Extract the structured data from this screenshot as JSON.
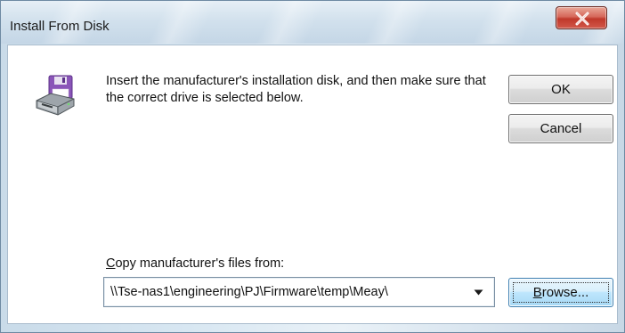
{
  "window": {
    "title": "Install From Disk"
  },
  "dialog": {
    "message": "Insert the manufacturer's installation disk, and then make sure that the correct drive is selected below.",
    "ok_label": "OK",
    "cancel_label": "Cancel",
    "copy_label_accel": "C",
    "copy_label_rest": "opy manufacturer's files from:",
    "path_value": "\\\\Tse-nas1\\engineering\\PJ\\Firmware\\temp\\Meay\\",
    "browse_accel": "B",
    "browse_rest": "rowse..."
  },
  "icons": {
    "disk": "floppy-disk-drive-icon",
    "close": "close-icon",
    "dropdown": "chevron-down-icon"
  },
  "colors": {
    "close_button": "#c0392b",
    "disk_purple": "#8a55b8",
    "focus_button": "#bee6fd"
  }
}
